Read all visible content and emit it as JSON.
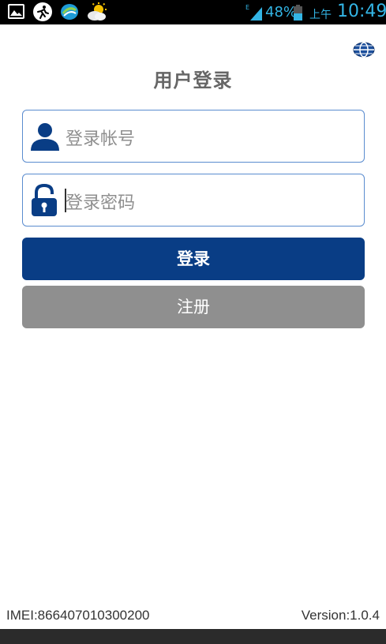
{
  "status_bar": {
    "battery_percent": "48%",
    "ampm": "上午",
    "time": "10:49",
    "network_type": "E",
    "accent_color": "#33b5e5"
  },
  "header": {
    "title": "用户登录",
    "globe_icon": "globe-icon"
  },
  "form": {
    "account_placeholder": "登录帐号",
    "password_placeholder": "登录密码",
    "account_icon": "user-icon",
    "password_icon": "lock-icon"
  },
  "buttons": {
    "login_label": "登录",
    "register_label": "注册",
    "login_color": "#093d85",
    "register_color": "#8f8f8f"
  },
  "footer": {
    "imei": "IMEI:866407010300200",
    "version": "Version:1.0.4"
  }
}
